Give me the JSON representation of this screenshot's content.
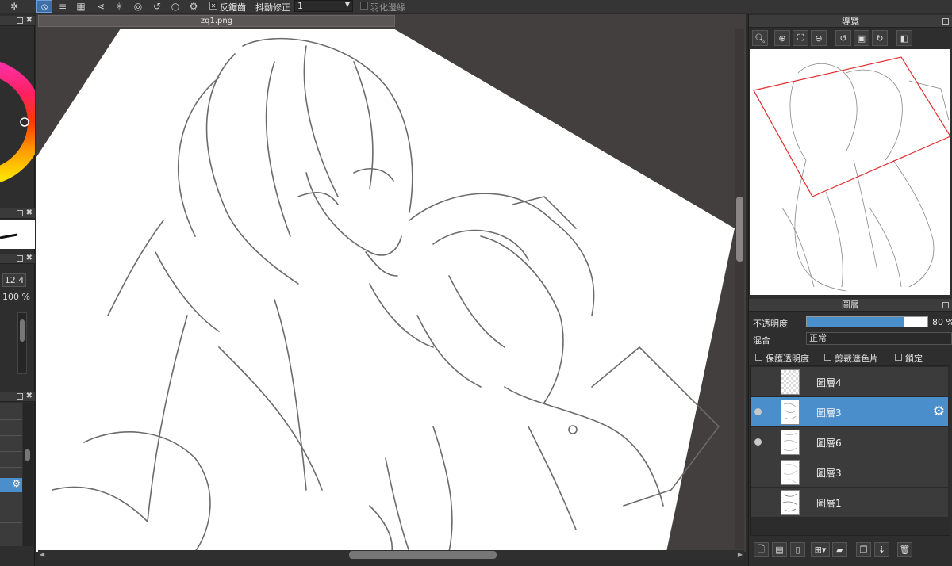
{
  "toolbar": {
    "antialias_label": "反鋸齒",
    "stabilizer_label": "抖動修正",
    "stabilizer_value": "1",
    "feather_label": "羽化邊緣"
  },
  "canvas": {
    "filename": "zq1.png"
  },
  "brush": {
    "size": "12.4",
    "opacity": "100 %"
  },
  "navigator": {
    "title": "導覽"
  },
  "layers_panel": {
    "title": "圖層",
    "opacity_label": "不透明度",
    "opacity_value": "80 %",
    "opacity_fraction": 0.8,
    "blend_label": "混合",
    "blend_value": "正常",
    "protect_alpha_label": "保護透明度",
    "clipping_label": "剪裁遮色片",
    "lock_label": "鎖定",
    "layers": [
      {
        "name": "圖層4",
        "visible": false,
        "selected": false
      },
      {
        "name": "圖層3",
        "visible": true,
        "selected": true
      },
      {
        "name": "圖層6",
        "visible": true,
        "selected": false
      },
      {
        "name": "圖層3",
        "visible": false,
        "selected": false
      },
      {
        "name": "圖層1",
        "visible": false,
        "selected": false
      }
    ]
  },
  "colors": {
    "accent": "#4a8ecb",
    "canvas_bg": "#433f3f",
    "navigator_frame": "#e03030"
  }
}
